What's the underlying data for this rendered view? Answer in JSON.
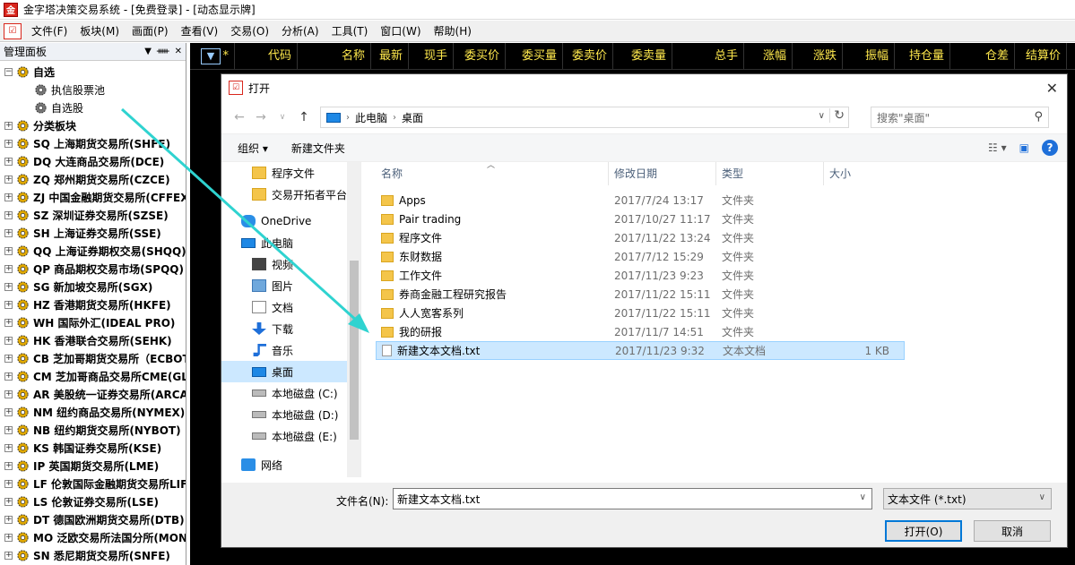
{
  "app": {
    "title": "金字塔决策交易系统 - [免费登录] - [动态显示牌]",
    "logo_text": "金"
  },
  "menubar": {
    "items": [
      "文件(F)",
      "板块(M)",
      "画面(P)",
      "查看(V)",
      "交易(O)",
      "分析(A)",
      "工具(T)",
      "窗口(W)",
      "帮助(H)"
    ]
  },
  "panel": {
    "title": "管理面板",
    "tree": [
      {
        "label": "自选",
        "expander": "−",
        "bold": true
      },
      {
        "label": "执信股票池",
        "child": true
      },
      {
        "label": "自选股",
        "child": true
      },
      {
        "label": "分类板块",
        "expander": "+",
        "bold": true
      },
      {
        "label": "SQ 上海期货交易所(SHFE)",
        "expander": "+"
      },
      {
        "label": "DQ 大连商品交易所(DCE)",
        "expander": "+"
      },
      {
        "label": "ZQ 郑州期货交易所(CZCE)",
        "expander": "+"
      },
      {
        "label": "ZJ 中国金融期货交易所(CFFEX)",
        "expander": "+"
      },
      {
        "label": "SZ 深圳证券交易所(SZSE)",
        "expander": "+"
      },
      {
        "label": "SH 上海证券交易所(SSE)",
        "expander": "+"
      },
      {
        "label": "QQ 上海证券期权交易(SHQQ)",
        "expander": "+"
      },
      {
        "label": "QP 商品期权交易市场(SPQQ)",
        "expander": "+"
      },
      {
        "label": "SG 新加坡交易所(SGX)",
        "expander": "+"
      },
      {
        "label": "HZ 香港期货交易所(HKFE)",
        "expander": "+"
      },
      {
        "label": "WH 国际外汇(IDEAL PRO)",
        "expander": "+"
      },
      {
        "label": "HK 香港联合交易所(SEHK)",
        "expander": "+"
      },
      {
        "label": "CB 芝加哥期货交易所（ECBOT)",
        "expander": "+"
      },
      {
        "label": "CM 芝加哥商品交易所CME(GLOBEX)",
        "expander": "+"
      },
      {
        "label": "AR 美股统一证券交易所(ARCA)",
        "expander": "+"
      },
      {
        "label": "NM 纽约商品交易所(NYMEX)",
        "expander": "+"
      },
      {
        "label": "NB 纽约期货交易所(NYBOT)",
        "expander": "+"
      },
      {
        "label": "KS 韩国证券交易所(KSE)",
        "expander": "+"
      },
      {
        "label": "IP 英国期货交易所(LME)",
        "expander": "+"
      },
      {
        "label": "LF 伦敦国际金融期货交易所LIFFE",
        "expander": "+"
      },
      {
        "label": "LS 伦敦证券交易所(LSE)",
        "expander": "+"
      },
      {
        "label": "DT 德国欧洲期货交易所(DTB)",
        "expander": "+"
      },
      {
        "label": "MO 泛欧交易所法国分所(MONEP)",
        "expander": "+"
      },
      {
        "label": "SN 悉尼期货交易所(SNFE)",
        "expander": "+"
      }
    ]
  },
  "quotes": {
    "dropdown": "▼",
    "columns": [
      "*",
      "代码",
      "名称",
      "最新",
      "现手",
      "委买价",
      "委买量",
      "委卖价",
      "委卖量",
      "总手",
      "涨幅",
      "涨跌",
      "振幅",
      "持仓量",
      "仓差",
      "结算价"
    ]
  },
  "dialog": {
    "title": "打开",
    "close": "✕",
    "path": [
      "此电脑",
      "桌面"
    ],
    "search_placeholder": "搜索\"桌面\"",
    "toolbar": {
      "organize": "组织 ▾",
      "new_folder": "新建文件夹"
    },
    "nav": [
      {
        "label": "程序文件",
        "icon": "folder",
        "indent": true
      },
      {
        "label": "交易开拓者平台",
        "icon": "folder",
        "indent": true
      },
      {
        "label": "OneDrive",
        "icon": "cloud"
      },
      {
        "label": "此电脑",
        "icon": "pc"
      },
      {
        "label": "视频",
        "icon": "video",
        "indent": true
      },
      {
        "label": "图片",
        "icon": "picture",
        "indent": true
      },
      {
        "label": "文档",
        "icon": "doc",
        "indent": true
      },
      {
        "label": "下载",
        "icon": "download",
        "indent": true
      },
      {
        "label": "音乐",
        "icon": "music",
        "indent": true
      },
      {
        "label": "桌面",
        "icon": "desktop",
        "indent": true,
        "selected": true
      },
      {
        "label": "本地磁盘 (C:)",
        "icon": "disk",
        "indent": true
      },
      {
        "label": "本地磁盘 (D:)",
        "icon": "disk",
        "indent": true
      },
      {
        "label": "本地磁盘 (E:)",
        "icon": "disk",
        "indent": true
      },
      {
        "label": "网络",
        "icon": "net"
      }
    ],
    "file_headers": {
      "name": "名称",
      "modified": "修改日期",
      "type": "类型",
      "size": "大小"
    },
    "files": [
      {
        "name": "Apps",
        "modified": "2017/7/24 13:17",
        "type": "文件夹",
        "size": "",
        "kind": "folder"
      },
      {
        "name": "Pair trading",
        "modified": "2017/10/27 11:17",
        "type": "文件夹",
        "size": "",
        "kind": "folder"
      },
      {
        "name": "程序文件",
        "modified": "2017/11/22 13:24",
        "type": "文件夹",
        "size": "",
        "kind": "folder"
      },
      {
        "name": "东财数据",
        "modified": "2017/7/12 15:29",
        "type": "文件夹",
        "size": "",
        "kind": "folder"
      },
      {
        "name": "工作文件",
        "modified": "2017/11/23 9:23",
        "type": "文件夹",
        "size": "",
        "kind": "folder"
      },
      {
        "name": "券商金融工程研究报告",
        "modified": "2017/11/22 15:11",
        "type": "文件夹",
        "size": "",
        "kind": "folder"
      },
      {
        "name": "人人宽客系列",
        "modified": "2017/11/22 15:11",
        "type": "文件夹",
        "size": "",
        "kind": "folder"
      },
      {
        "name": "我的研报",
        "modified": "2017/11/7 14:51",
        "type": "文件夹",
        "size": "",
        "kind": "folder"
      },
      {
        "name": "新建文本文档.txt",
        "modified": "2017/11/23 9:32",
        "type": "文本文档",
        "size": "1 KB",
        "kind": "txt",
        "selected": true
      }
    ],
    "filename_label": "文件名(N):",
    "filename_value": "新建文本文档.txt",
    "filetype_value": "文本文件 (*.txt)",
    "open_button": "打开(O)",
    "cancel_button": "取消"
  },
  "colors": {
    "accent": "#0078d7",
    "quote_header_text": "#ffe94d",
    "annotation_arrow": "#2fd3d0",
    "selection": "#cce8ff"
  }
}
